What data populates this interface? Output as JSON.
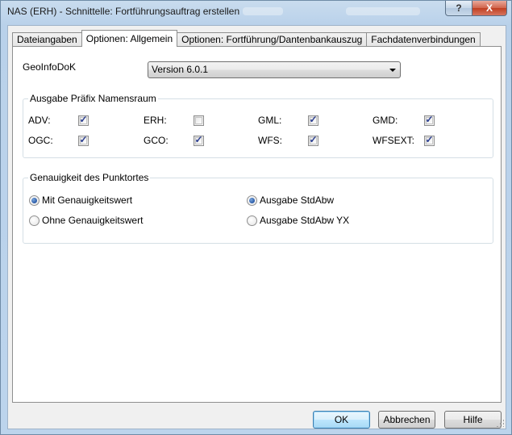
{
  "window": {
    "title": "NAS (ERH) - Schnittelle: Fortführungsauftrag erstellen",
    "help_label": "?",
    "close_label": "X"
  },
  "tabs": [
    {
      "label": "Dateiangaben"
    },
    {
      "label": "Optionen: Allgemein"
    },
    {
      "label": "Optionen: Fortführung/Dantenbankauszug"
    },
    {
      "label": "Fachdatenverbindungen"
    }
  ],
  "geoinfodok": {
    "label": "GeoInfoDoK",
    "selected": "Version 6.0.1"
  },
  "prefix_group": {
    "title": "Ausgabe Präfix Namensraum",
    "items": [
      {
        "label": "ADV:",
        "checked": true
      },
      {
        "label": "ERH:",
        "checked": false
      },
      {
        "label": "GML:",
        "checked": true
      },
      {
        "label": "GMD:",
        "checked": true
      },
      {
        "label": "OGC:",
        "checked": true
      },
      {
        "label": "GCO:",
        "checked": true
      },
      {
        "label": "WFS:",
        "checked": true
      },
      {
        "label": "WFSEXT:",
        "checked": true
      }
    ]
  },
  "accuracy_group": {
    "title": "Genauigkeit des Punktortes",
    "options": [
      {
        "label": "Mit Genauigkeitswert",
        "selected": true
      },
      {
        "label": "Ohne Genauigkeitswert",
        "selected": false
      },
      {
        "label": "Ausgabe StdAbw",
        "selected": true
      },
      {
        "label": "Ausgabe StdAbw YX",
        "selected": false
      }
    ]
  },
  "buttons": {
    "ok": "OK",
    "cancel": "Abbrechen",
    "help": "Hilfe"
  },
  "check_glyph": "✓"
}
